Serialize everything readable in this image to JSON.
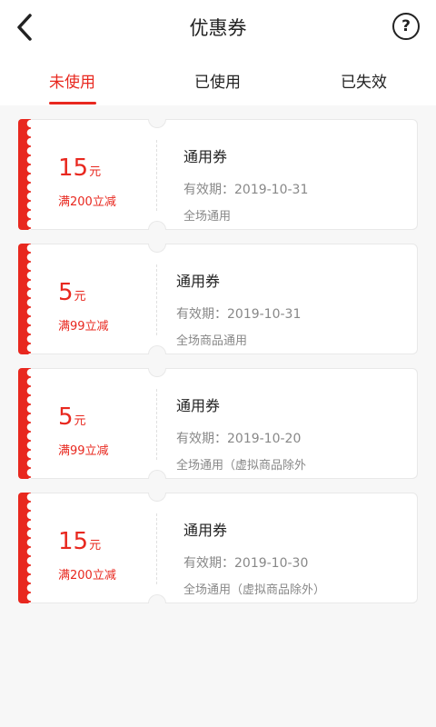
{
  "header": {
    "title": "优惠券",
    "back_icon": "chevron-left-icon",
    "help_icon": "help-icon",
    "help_symbol": "?"
  },
  "tabs": [
    {
      "label": "未使用",
      "active": true
    },
    {
      "label": "已使用",
      "active": false
    },
    {
      "label": "已失效",
      "active": false
    }
  ],
  "colors": {
    "accent": "#e8281f",
    "text": "#222222",
    "muted": "#888888",
    "background": "#f7f7f7"
  },
  "coupons": [
    {
      "amount": "15",
      "unit": "元",
      "condition": "满200立减",
      "name": "通用券",
      "expiry": "有效期：2019-10-31",
      "scope": "全场通用"
    },
    {
      "amount": "5",
      "unit": "元",
      "condition": "满99立减",
      "name": "通用券",
      "expiry": "有效期：2019-10-31",
      "scope": "全场商品通用"
    },
    {
      "amount": "5",
      "unit": "元",
      "condition": "满99立减",
      "name": "通用券",
      "expiry": "有效期：2019-10-20",
      "scope": "全场通用（虚拟商品除外"
    },
    {
      "amount": "15",
      "unit": "元",
      "condition": "满200立减",
      "name": "通用券",
      "expiry": "有效期：2019-10-30",
      "scope": "全场通用（虚拟商品除外）"
    }
  ]
}
